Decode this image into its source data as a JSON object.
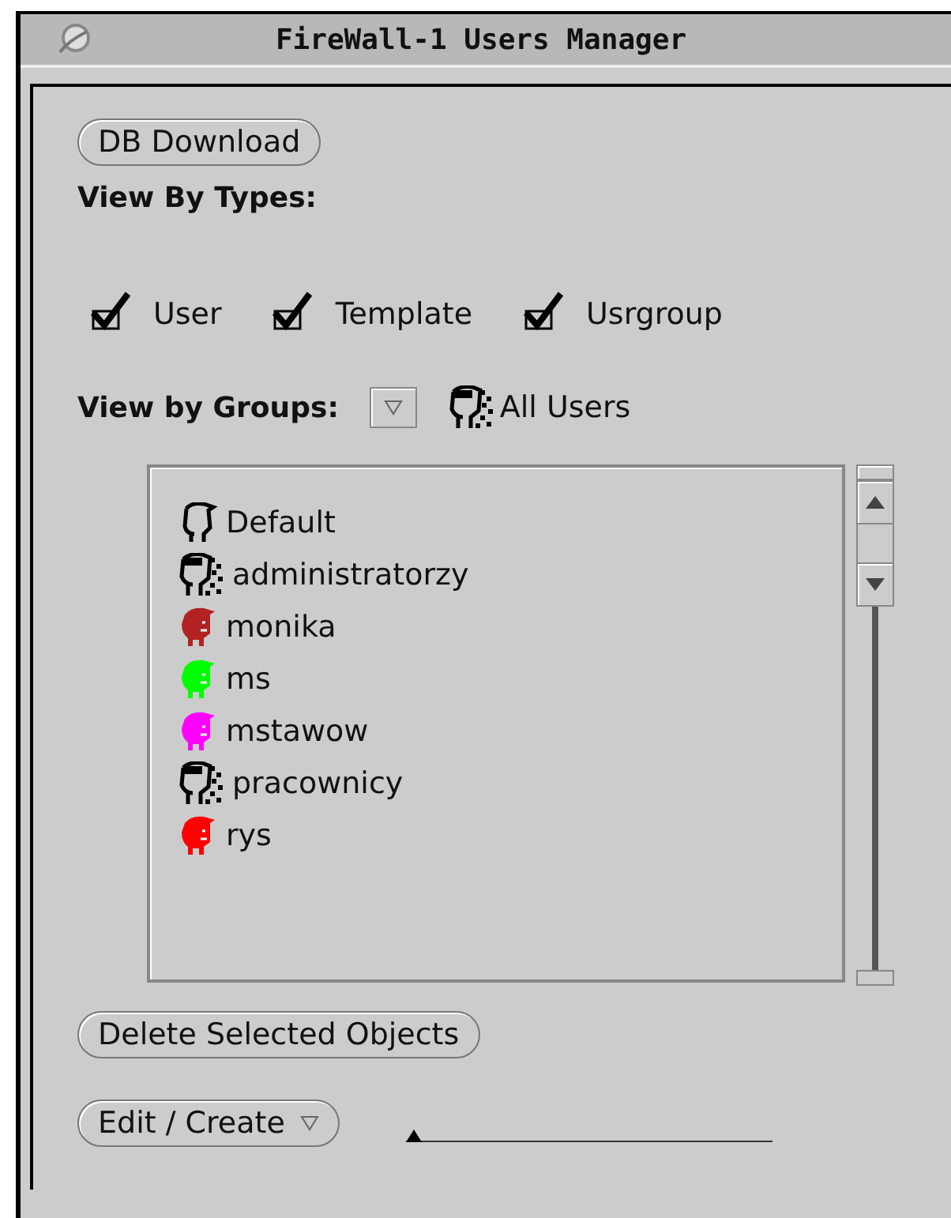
{
  "window": {
    "title": "FireWall-1 Users Manager"
  },
  "db_download_button": "DB Download",
  "view_by_types": {
    "label": "View By Types:",
    "types": [
      {
        "label": "User",
        "checked": true
      },
      {
        "label": "Template",
        "checked": true
      },
      {
        "label": "Usrgroup",
        "checked": true
      }
    ]
  },
  "view_by_groups": {
    "label": "View by Groups:",
    "selection": "All Users"
  },
  "users_list": [
    {
      "name": "Default",
      "kind": "template"
    },
    {
      "name": "administratorzy",
      "kind": "group"
    },
    {
      "name": "monika",
      "kind": "user",
      "color": "#b22222"
    },
    {
      "name": "ms",
      "kind": "user",
      "color": "#00ff00"
    },
    {
      "name": "mstawow",
      "kind": "user",
      "color": "#ff00ff"
    },
    {
      "name": "pracownicy",
      "kind": "group"
    },
    {
      "name": "rys",
      "kind": "user",
      "color": "#ff0000"
    }
  ],
  "delete_button": "Delete Selected Objects",
  "edit_create_button": "Edit / Create",
  "slider": {
    "level": 0
  }
}
